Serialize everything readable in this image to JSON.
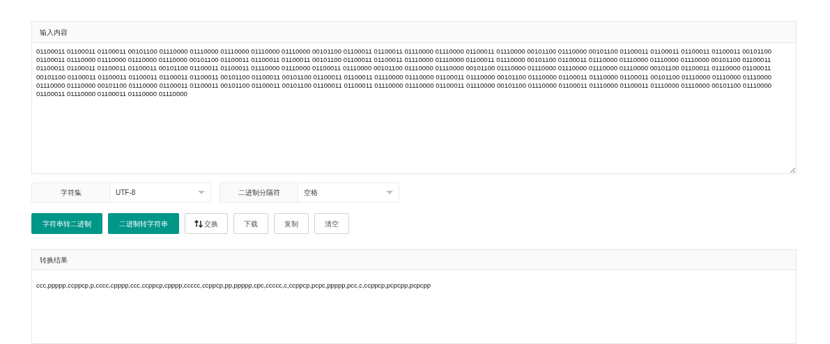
{
  "input_panel": {
    "title": "输入内容",
    "value": "01100011 01100011 01100011 00101100 01110000 01110000 01110000 01110000 01110000 00101100 01100011 01100011 01110000 01110000 01100011 01110000 00101100 01110000 00101100 01100011 01100011 01100011 01100011 00101100 01100011 01110000 01110000 01110000 01110000 00101100 01100011 01100011 01100011 00101100 01100011 01100011 01110000 01110000 01100011 01110000 00101100 01100011 01110000 01110000 01110000 01110000 00101100 01100011 01100011 01100011 01100011 01100011 00101100 01100011 01100011 01110000 01110000 01100011 01110000 00101100 01110000 01110000 00101100 01110000 01110000 01110000 01110000 01110000 00101100 01100011 01110000 01100011 00101100 01100011 01100011 01100011 01100011 01100011 00101100 01100011 00101100 01100011 01100011 01110000 01110000 01100011 01110000 00101100 01110000 01100011 01110000 01100011 00101100 01110000 01110000 01110000 01110000 01110000 00101100 01110000 01100011 01100011 00101100 01100011 00101100 01100011 01100011 01110000 01110000 01100011 01110000 00101100 01110000 01100011 01110000 01100011 01110000 01110000 00101100 01110000 01100011 01110000 01100011 01110000 01110000"
  },
  "options": [
    {
      "label": "字符集",
      "value": "UTF-8"
    },
    {
      "label": "二进制分隔符",
      "value": "空格"
    }
  ],
  "buttons": [
    {
      "label": "字符串转二进制",
      "kind": "primary"
    },
    {
      "label": "二进制转字符串",
      "kind": "primary"
    },
    {
      "label": "交换",
      "kind": "swap"
    },
    {
      "label": "下载",
      "kind": "plain"
    },
    {
      "label": "复制",
      "kind": "plain"
    },
    {
      "label": "清空",
      "kind": "plain"
    }
  ],
  "output_panel": {
    "title": "转换结果",
    "value": "ccc,ppppp,ccppcp,p,cccc,cpppp,ccc,ccppcp,cpppp,ccccc,ccppcp,pp,ppppp,cpc,ccccc,c,ccppcp,pcpc,ppppp,pcc,c,ccppcp,pcpcpp,pcpcpp"
  }
}
